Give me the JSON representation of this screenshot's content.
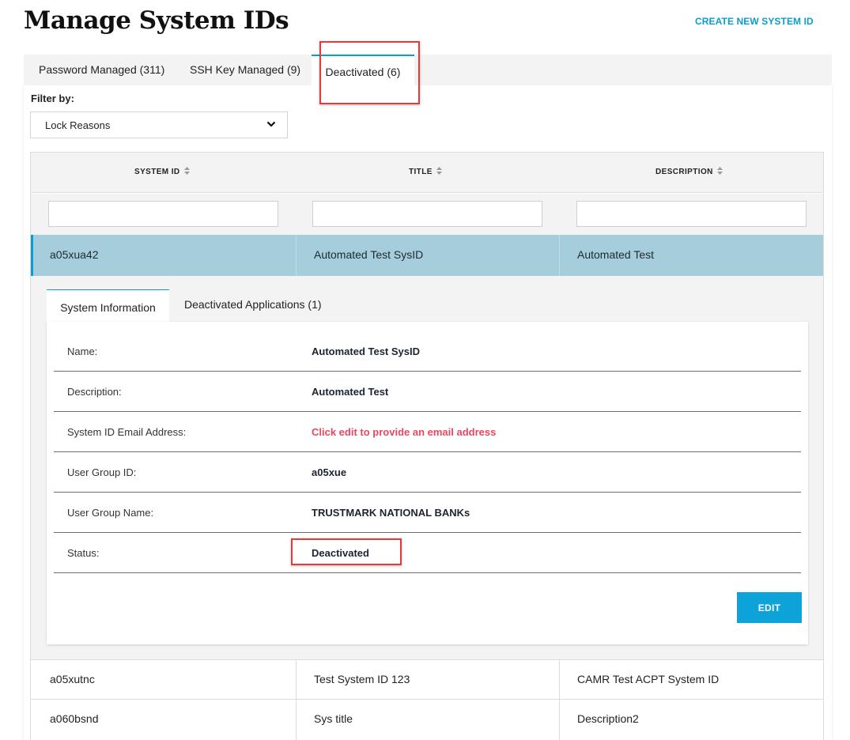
{
  "header": {
    "title": "Manage System IDs",
    "create_link": "CREATE NEW SYSTEM ID"
  },
  "tabs": [
    {
      "label": "Password Managed (311)"
    },
    {
      "label": "SSH Key Managed (9)"
    },
    {
      "label": "Deactivated (6)",
      "active": true
    }
  ],
  "filter": {
    "label": "Filter by:",
    "selected": "Lock Reasons"
  },
  "table": {
    "columns": [
      "SYSTEM ID",
      "TITLE",
      "DESCRIPTION"
    ],
    "selected_row": {
      "system_id": "a05xua42",
      "title": "Automated Test SysID",
      "description": "Automated Test"
    },
    "rows": [
      {
        "system_id": "a05xutnc",
        "title": "Test System ID 123",
        "description": "CAMR Test ACPT System ID"
      },
      {
        "system_id": "a060bsnd",
        "title": "Sys title",
        "description": "Description2"
      }
    ]
  },
  "detail": {
    "tabs": [
      "System Information",
      "Deactivated Applications (1)"
    ],
    "fields": [
      {
        "key": "Name:",
        "value": "Automated Test SysID"
      },
      {
        "key": "Description:",
        "value": "Automated Test"
      },
      {
        "key": "System ID Email Address:",
        "value": "Click edit to provide an email address"
      },
      {
        "key": "User Group ID:",
        "value": "a05xue"
      },
      {
        "key": "User Group Name:",
        "value": "TRUSTMARK NATIONAL BANKs"
      },
      {
        "key": "Status:",
        "value": "Deactivated"
      }
    ],
    "edit_label": "EDIT"
  },
  "colors": {
    "accent": "#0b9cd1",
    "selected_row": "#a6cddb",
    "warning_text": "#ec4560",
    "highlight_box": "#e53a3a"
  }
}
